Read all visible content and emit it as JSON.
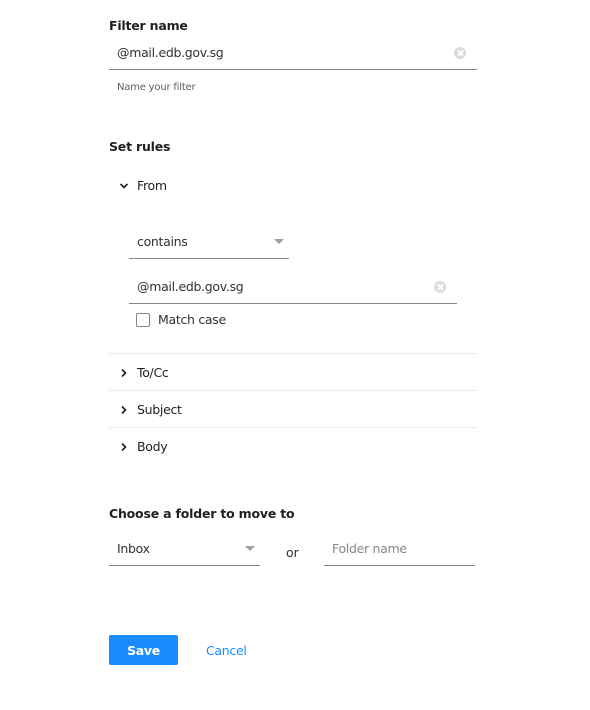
{
  "filter_name": {
    "heading": "Filter name",
    "value": "@mail.edb.gov.sg",
    "hint": "Name your filter"
  },
  "rules": {
    "heading": "Set rules",
    "from": {
      "label": "From",
      "expanded": true,
      "condition": "contains",
      "value": "@mail.edb.gov.sg",
      "match_case_label": "Match case",
      "match_case_checked": false
    },
    "collapsed_items": [
      {
        "label": "To/Cc"
      },
      {
        "label": "Subject"
      },
      {
        "label": "Body"
      }
    ]
  },
  "folder": {
    "heading": "Choose a folder to move to",
    "selected": "Inbox",
    "or_label": "or",
    "folder_name_placeholder": "Folder name",
    "folder_name_value": ""
  },
  "actions": {
    "save_label": "Save",
    "cancel_label": "Cancel"
  },
  "colors": {
    "accent": "#1b8cff",
    "underline": "#8a8886",
    "divider": "#edebe9"
  }
}
